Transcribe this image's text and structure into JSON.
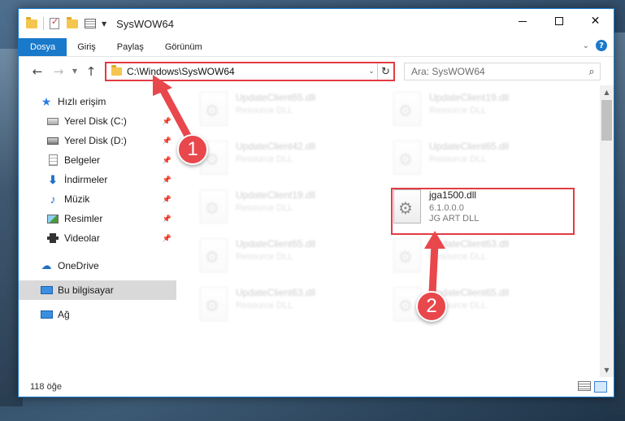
{
  "window": {
    "title": "SysWOW64"
  },
  "ribbon": {
    "tabs": [
      "Dosya",
      "Giriş",
      "Paylaş",
      "Görünüm"
    ],
    "help": "?"
  },
  "address": {
    "path": "C:\\Windows\\SysWOW64",
    "search_placeholder": "Ara: SysWOW64"
  },
  "sidebar": {
    "quick_access": "Hızlı erişim",
    "items": [
      {
        "label": "Yerel Disk (C:)",
        "icon": "drive-icon"
      },
      {
        "label": "Yerel Disk (D:)",
        "icon": "usb-drive-icon"
      },
      {
        "label": "Belgeler",
        "icon": "documents-icon"
      },
      {
        "label": "İndirmeler",
        "icon": "downloads-icon"
      },
      {
        "label": "Müzik",
        "icon": "music-icon"
      },
      {
        "label": "Resimler",
        "icon": "pictures-icon"
      },
      {
        "label": "Videolar",
        "icon": "videos-icon"
      }
    ],
    "onedrive": "OneDrive",
    "this_pc": "Bu bilgisayar",
    "network": "Ağ"
  },
  "files": {
    "left_column": [
      {
        "name": "UpdateClient65.dll",
        "type": "Resource DLL"
      },
      {
        "name": "UpdateClient42.dll",
        "type": "Resource DLL"
      },
      {
        "name": "UpdateClient19.dll",
        "type": "Resource DLL"
      },
      {
        "name": "UpdateClient65.dll",
        "type": "Resource DLL"
      },
      {
        "name": "UpdateClient63.dll",
        "type": "Resource DLL"
      }
    ],
    "right_column": [
      {
        "name": "UpdateClient19.dll",
        "type": "Resource DLL"
      },
      {
        "name": "UpdateClient65.dll",
        "type": "Resource DLL"
      },
      {
        "name": "UpdateClient63.dll",
        "type": "Resource DLL"
      },
      {
        "name": "UpdateClient65.dll",
        "type": "Resource DLL"
      }
    ],
    "highlighted": {
      "name": "jga1500.dll",
      "version": "6.1.0.0.0",
      "description": "JG ART DLL"
    }
  },
  "status": {
    "item_count": "118 öğe"
  },
  "annotations": {
    "step1": "1",
    "step2": "2",
    "color": "#e8474c"
  }
}
